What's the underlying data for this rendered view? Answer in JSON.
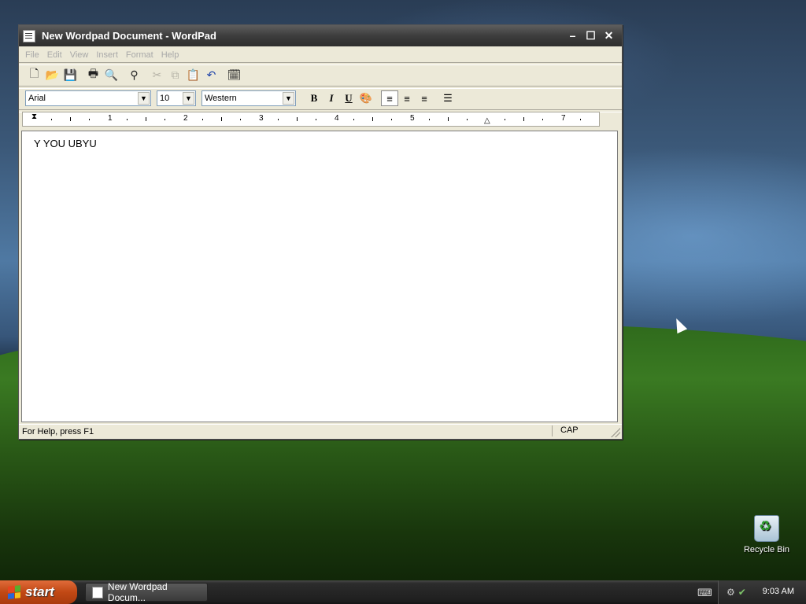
{
  "window": {
    "title": "New Wordpad Document - WordPad",
    "buttons": {
      "minimize": "–",
      "maximize": "☐",
      "close": "✕"
    }
  },
  "menu": [
    "File",
    "Edit",
    "View",
    "Insert",
    "Format",
    "Help"
  ],
  "toolbar": {
    "icons": [
      "new-icon",
      "open-icon",
      "save-icon",
      "print-icon",
      "print-preview-icon",
      "find-icon",
      "cut-icon",
      "copy-icon",
      "paste-icon",
      "undo-icon",
      "date-time-icon"
    ]
  },
  "format_bar": {
    "font": "Arial",
    "size": "10",
    "script": "Western",
    "bold": "B",
    "italic": "I",
    "underline": "U"
  },
  "ruler": {
    "numbers": [
      "1",
      "2",
      "3",
      "4",
      "5",
      "7"
    ]
  },
  "document": {
    "text": "Y YOU UBYU"
  },
  "status": {
    "help": "For Help, press F1",
    "cap": "CAP"
  },
  "desktop": {
    "recycle_bin": "Recycle Bin"
  },
  "taskbar": {
    "start": "start",
    "task": "New Wordpad Docum...",
    "clock": "9:03 AM"
  }
}
